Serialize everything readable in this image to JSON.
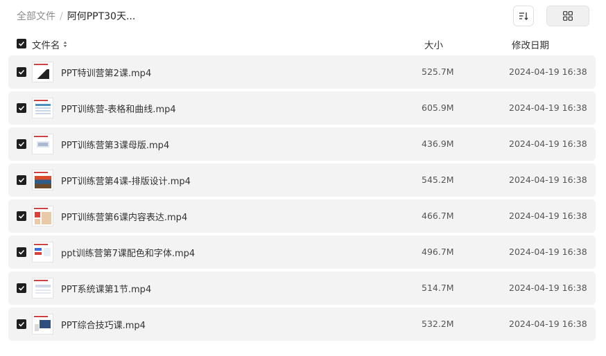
{
  "breadcrumb": {
    "root": "全部文件",
    "separator": "/",
    "current": "阿何PPT30天..."
  },
  "columns": {
    "name": "文件名",
    "size": "大小",
    "modified": "修改日期"
  },
  "files": [
    {
      "name": "PPT特训营第2课.mp4",
      "size": "525.7M",
      "modified": "2024-04-19 16:38",
      "checked": true
    },
    {
      "name": "PPT训练营-表格和曲线.mp4",
      "size": "605.9M",
      "modified": "2024-04-19 16:38",
      "checked": true
    },
    {
      "name": "PPT训练营第3课母版.mp4",
      "size": "436.9M",
      "modified": "2024-04-19 16:38",
      "checked": true
    },
    {
      "name": "PPT训练营第4课-排版设计.mp4",
      "size": "545.2M",
      "modified": "2024-04-19 16:38",
      "checked": true
    },
    {
      "name": "PPT训练营第6课内容表达.mp4",
      "size": "466.7M",
      "modified": "2024-04-19 16:38",
      "checked": true
    },
    {
      "name": "ppt训练营第7课配色和字体.mp4",
      "size": "496.7M",
      "modified": "2024-04-19 16:38",
      "checked": true
    },
    {
      "name": "PPT系统课第1节.mp4",
      "size": "514.7M",
      "modified": "2024-04-19 16:38",
      "checked": true
    },
    {
      "name": "PPT综合技巧课.mp4",
      "size": "532.2M",
      "modified": "2024-04-19 16:38",
      "checked": true
    }
  ],
  "icons": {
    "sort": "sort-icon",
    "list_view": "list-view-icon",
    "grid_view": "grid-view-icon",
    "checkbox": "checkbox-checked-icon"
  },
  "colors": {
    "row_bg": "#f3f3f3",
    "checkbox": "#1f1f1f",
    "text": "#333333"
  }
}
